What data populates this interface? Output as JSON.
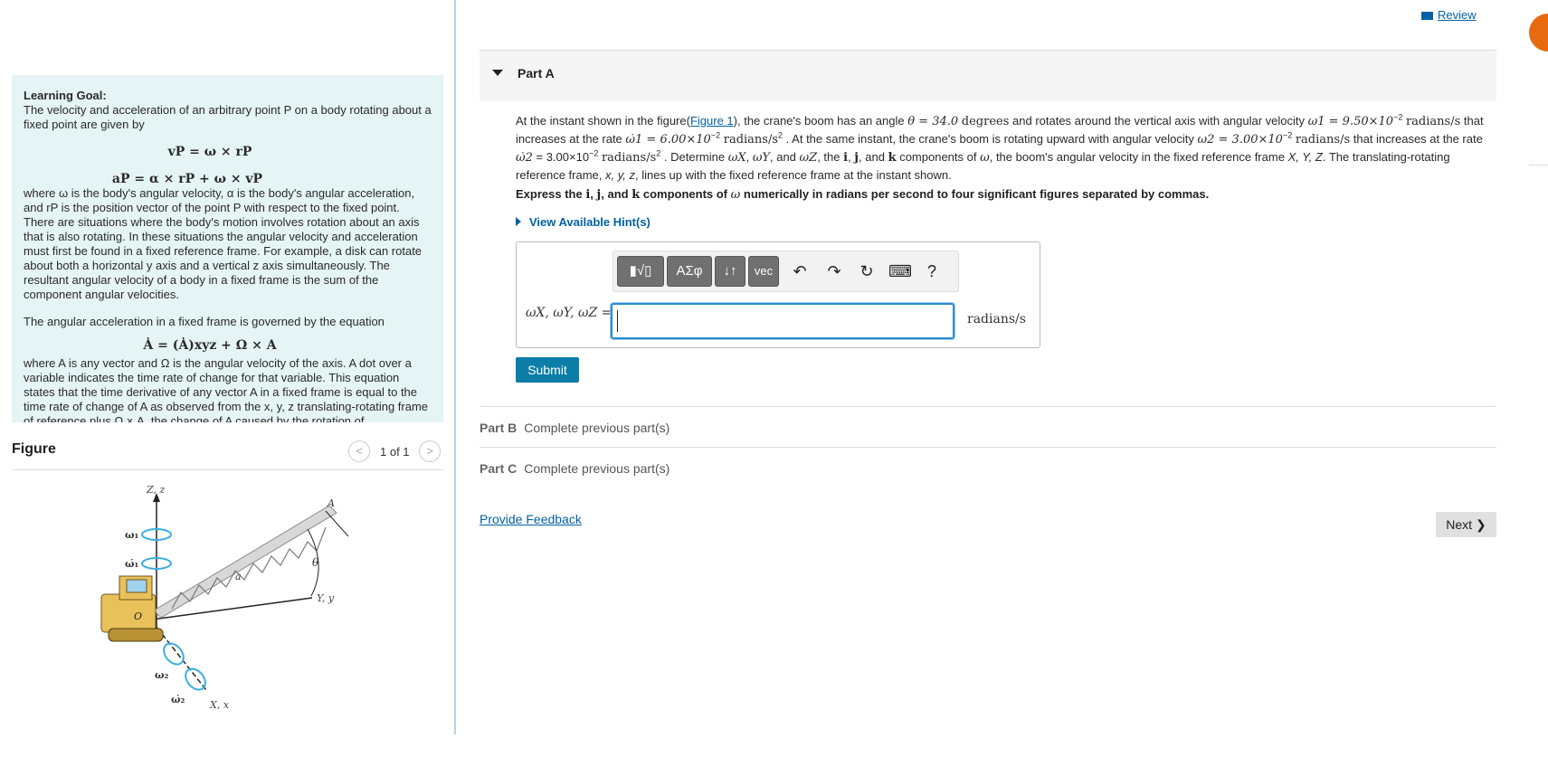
{
  "header": {
    "review_label": "Review"
  },
  "learning_goal": {
    "title": "Learning Goal:",
    "p1": "The velocity and acceleration of an arbitrary point P on a body rotating about a fixed point are given by",
    "eq_v": "vP = ω × rP",
    "eq_a": "aP = α × rP + ω × vP",
    "p2": "where ω is the body's angular velocity, α is the body's angular acceleration, and rP is the position vector of the point P with respect to the fixed point. There are situations where the body's motion involves rotation about an axis that is also rotating. In these situations the angular velocity and acceleration must first be found in a fixed reference frame.  For example, a disk can rotate about both a horizontal y axis and a vertical z axis simultaneously. The resultant angular velocity of a body in a fixed frame is the sum of the component angular velocities.",
    "p3": "The angular acceleration in a fixed frame is governed by the equation",
    "eq_A": "Ȧ = (Ȧ)xyz + Ω × A",
    "p4": "where A is any vector and Ω is the angular velocity of the axis. A dot over a variable indicates the time rate of change for that variable. This equation states that the time derivative of any vector A in a fixed frame is equal to the time rate of change of A as observed from the x, y, z translating-rotating frame of reference plus Ω × A, the change of A caused by the rotation of"
  },
  "figure": {
    "title": "Figure",
    "pager": "1 of 1",
    "labels": {
      "zz": "Z, z",
      "w1": "ω₁",
      "w1dot": "ω̇₁",
      "A": "A",
      "theta": "θ",
      "a": "a",
      "O": "O",
      "yy": "Y, y",
      "w2": "ω₂",
      "w2dot": "ω̇₂",
      "xx": "X, x"
    }
  },
  "partA": {
    "title": "Part A",
    "problem": {
      "s1": "At the instant shown in the figure(",
      "fig_link": "Figure 1",
      "s2": "), the crane's boom has an angle",
      "theta_val": "θ = 34.0",
      "deg": "degrees",
      "s3": "and rotates around the vertical axis with angular velocity",
      "w1": "ω1 = 9.50×10",
      "w1_exp": "−2",
      "unit_rad": "radians/s",
      "s4": "that increases at the rate",
      "w1dot": "ω̇1 = 6.00×10",
      "w1dot_exp": "−2",
      "unit_rad2": "radians/s",
      "s5": ". At the same instant, the crane's boom is rotating upward with angular velocity",
      "w2": "ω2 = 3.00×10",
      "w2_exp": "−2",
      "s6": "that increases at the rate",
      "w2dot": "ω̇2",
      "w2dot_val": "= 3.00×10",
      "w2dot_exp": "−2",
      "s7": ".  Determine",
      "wx": "ωX",
      "wy": "ωY",
      "s8": ", and",
      "wz": "ωZ",
      "s9": ", the",
      "i": "i",
      "j": "j",
      "s10": ", and",
      "k": "k",
      "s11": "components of",
      "w": "ω",
      "s12": ", the boom's angular velocity in the fixed reference frame",
      "frameXYZ": "X, Y, Z",
      "s13": ". The translating-rotating reference frame,",
      "framexyz": "x, y, z",
      "s14": ", lines up with the fixed reference frame at the instant shown."
    },
    "express": {
      "s1": "Express the",
      "i": "i",
      "j": "j",
      "s2": ", and",
      "k": "k",
      "s3": "components of",
      "w": "ω",
      "s4": "numerically in radians per second to four significant figures separated by commas."
    },
    "hint_label": "View Available Hint(s)",
    "toolbar": {
      "templates": "▮√▯",
      "greek": "ΑΣφ",
      "arrows": "↓↑",
      "vec": "vec",
      "undo": "↶",
      "redo": "↷",
      "reset": "↻",
      "keyboard": "⌨",
      "help": "?"
    },
    "answer_label": "ωX, ωY, ωZ =",
    "answer_value": "",
    "answer_unit": "radians/s",
    "submit_label": "Submit"
  },
  "partB": {
    "title": "Part B",
    "status": "Complete previous part(s)"
  },
  "partC": {
    "title": "Part C",
    "status": "Complete previous part(s)"
  },
  "footer": {
    "feedback_label": "Provide Feedback",
    "next_label": "Next"
  }
}
